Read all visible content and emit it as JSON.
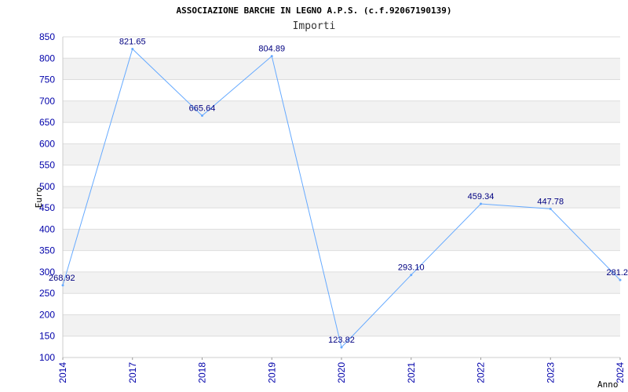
{
  "chart_data": {
    "type": "line",
    "title": "ASSOCIAZIONE BARCHE IN LEGNO A.P.S. (c.f.92067190139)",
    "subtitle": "Importi",
    "xlabel": "Anno",
    "ylabel": "Euro",
    "categories": [
      "2014",
      "2017",
      "2018",
      "2019",
      "2020",
      "2021",
      "2022",
      "2023",
      "2024"
    ],
    "values": [
      268.92,
      821.65,
      665.64,
      804.89,
      123.82,
      293.1,
      459.34,
      447.78,
      281.2
    ],
    "value_labels": [
      "268.92",
      "821.65",
      "665.64",
      "804.89",
      "123.82",
      "293.10",
      "459.34",
      "447.78",
      "281.2"
    ],
    "yticks": [
      "100",
      "150",
      "200",
      "250",
      "300",
      "350",
      "400",
      "450",
      "500",
      "550",
      "600",
      "650",
      "700",
      "750",
      "800",
      "850"
    ],
    "ylim": [
      100,
      850
    ],
    "grid": true,
    "band_colors": [
      "#f2f2f2",
      "#ffffff"
    ],
    "line_color": "#66aaff",
    "tick_color": "#0000aa",
    "label_color": "#000080"
  }
}
